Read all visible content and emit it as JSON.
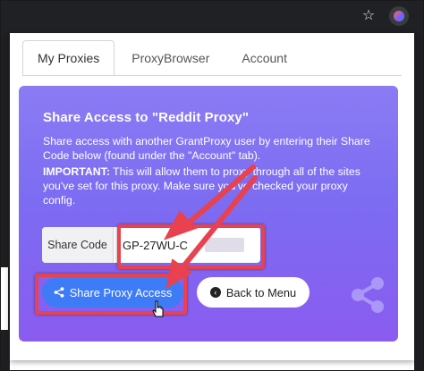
{
  "browser": {
    "bookmark_icon": "star-icon",
    "extension_icon": "grantproxy-extension-icon"
  },
  "tabs": [
    {
      "label": "My Proxies",
      "active": true
    },
    {
      "label": "ProxyBrowser",
      "active": false
    },
    {
      "label": "Account",
      "active": false
    }
  ],
  "card": {
    "title": "Share Access to \"Reddit Proxy\"",
    "description": "Share access with another GrantProxy user by entering their Share Code below (found under the \"Account\" tab).",
    "important_label": "IMPORTANT:",
    "important_text": " This will allow them to proxy through all of the sites you've set for this proxy. Make sure you've checked your proxy config.",
    "share_code_label": "Share Code",
    "share_code_value": "GP-27WU-C",
    "share_button_label": "Share Proxy Access",
    "back_button_label": "Back to Menu",
    "share_icon": "share-icon",
    "back_icon": "chevron-left-circle-icon"
  },
  "colors": {
    "card_gradient_top": "#8b7cf4",
    "card_gradient_bottom": "#8a5cf0",
    "primary_button": "#3d7bf7",
    "annotation_red": "#e8414f"
  }
}
